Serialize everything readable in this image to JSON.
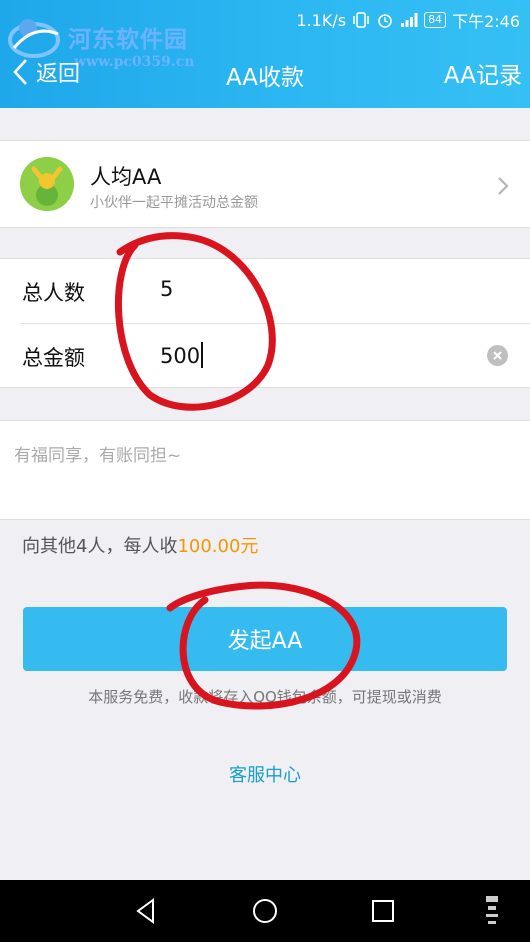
{
  "status_bar": {
    "net_speed": "1.1K/s",
    "battery": "84",
    "time": "下午2:46"
  },
  "watermark": {
    "title": "河东软件园",
    "url": "www.pc0359.cn"
  },
  "nav": {
    "back_label": "返回",
    "title": "AA收款",
    "right_label": "AA记录"
  },
  "aa_option": {
    "title": "人均AA",
    "subtitle": "小伙伴一起平摊活动总金额"
  },
  "form": {
    "people_label": "总人数",
    "people_value": "5",
    "amount_label": "总金额",
    "amount_value": "500"
  },
  "note": {
    "placeholder": "有福同享，有账同担~"
  },
  "summary": {
    "prefix": "向其他4人，每人收",
    "amount": "100.00元"
  },
  "actions": {
    "primary_label": "发起AA",
    "service_note": "本服务免费，收款将存入QQ钱包余额，可提现或消费",
    "service_link": "客服中心"
  },
  "colors": {
    "header_blue": "#2cb7f2",
    "button_blue": "#35bbf0",
    "amount_orange": "#f39800",
    "annotation_red": "#d8141e"
  }
}
